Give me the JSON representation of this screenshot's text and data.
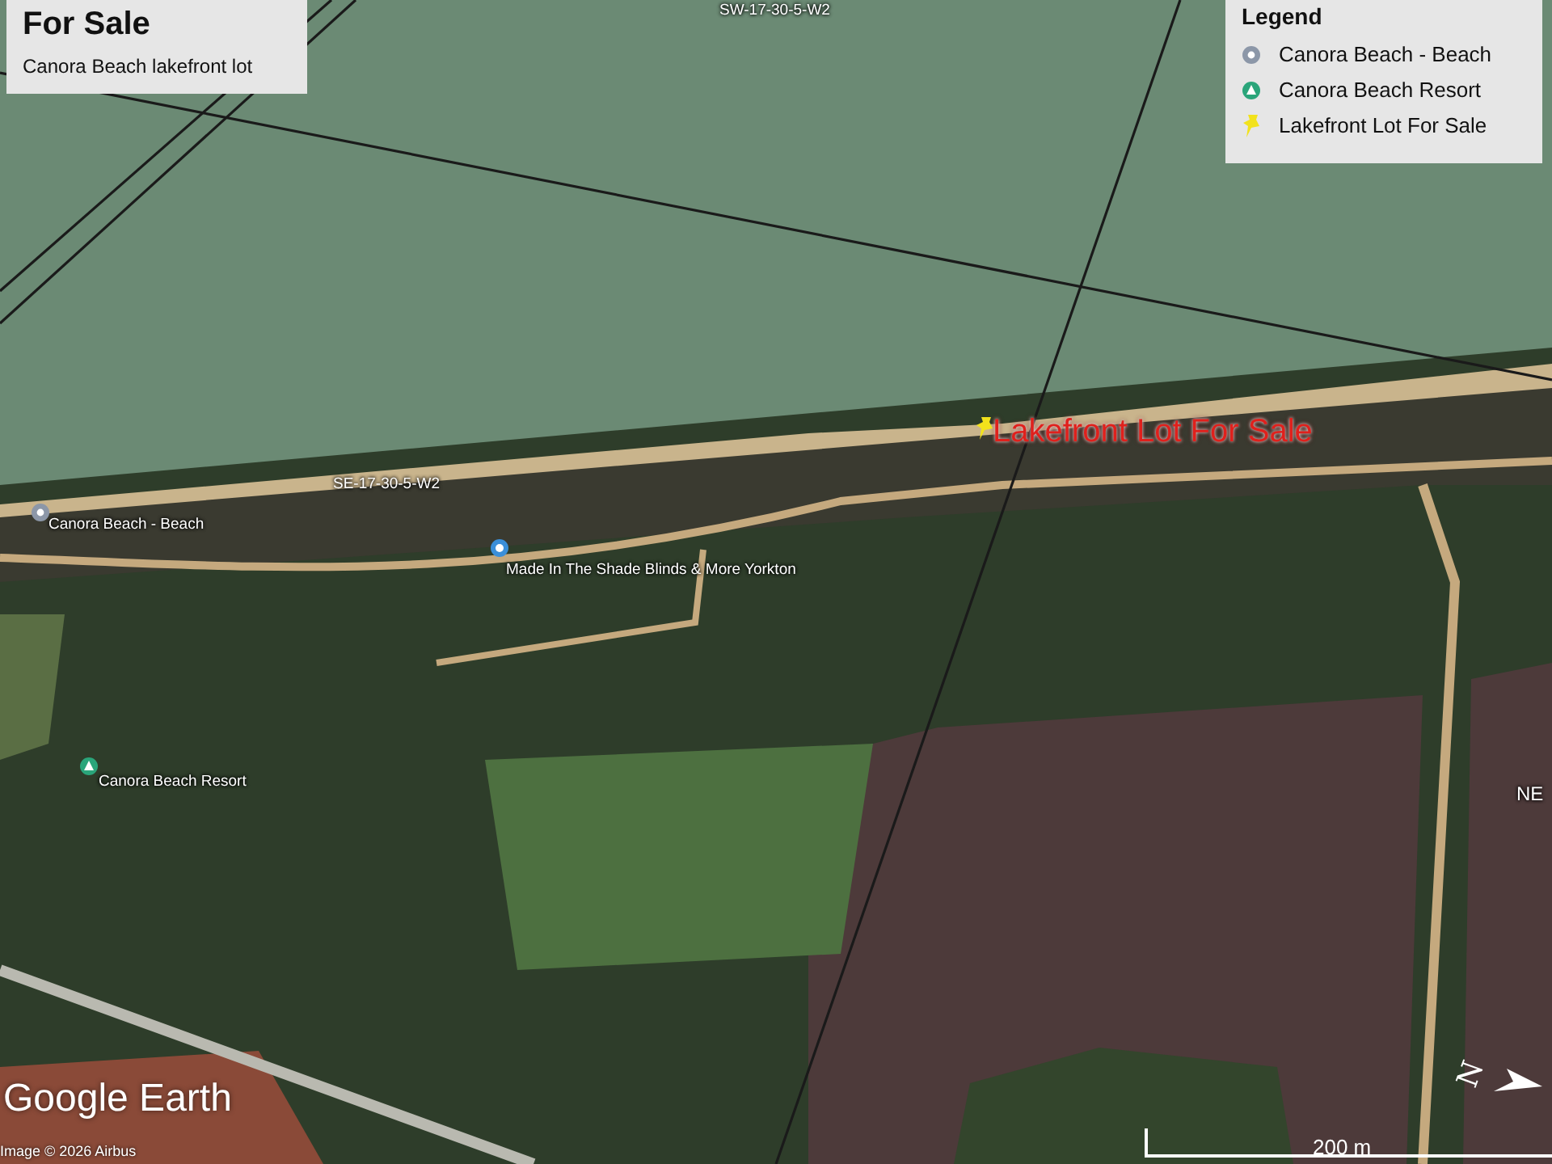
{
  "info_box": {
    "title": "For Sale",
    "subtitle": "Canora Beach lakefront lot"
  },
  "legend": {
    "title": "Legend",
    "items": [
      {
        "kind": "beach",
        "label": "Canora Beach - Beach"
      },
      {
        "kind": "resort",
        "label": "Canora Beach Resort"
      },
      {
        "kind": "pushpin",
        "label": "Lakefront Lot For Sale"
      }
    ]
  },
  "map_labels": [
    {
      "kind": "parcel",
      "text": "SW-17-30-5-W2"
    },
    {
      "kind": "parcel",
      "text": "SE-17-30-5-W2"
    },
    {
      "kind": "beach",
      "text": "Canora Beach - Beach"
    },
    {
      "kind": "business",
      "text": "Made In The Shade Blinds & More Yorkton"
    },
    {
      "kind": "resort",
      "text": "Canora Beach Resort"
    },
    {
      "kind": "pushpin",
      "text": "Lakefront Lot For Sale"
    },
    {
      "kind": "parcel",
      "text": "NE"
    }
  ],
  "brand": "Google Earth",
  "attribution": "Image © 2026 Airbus",
  "scale": "200 m",
  "compass": "N"
}
